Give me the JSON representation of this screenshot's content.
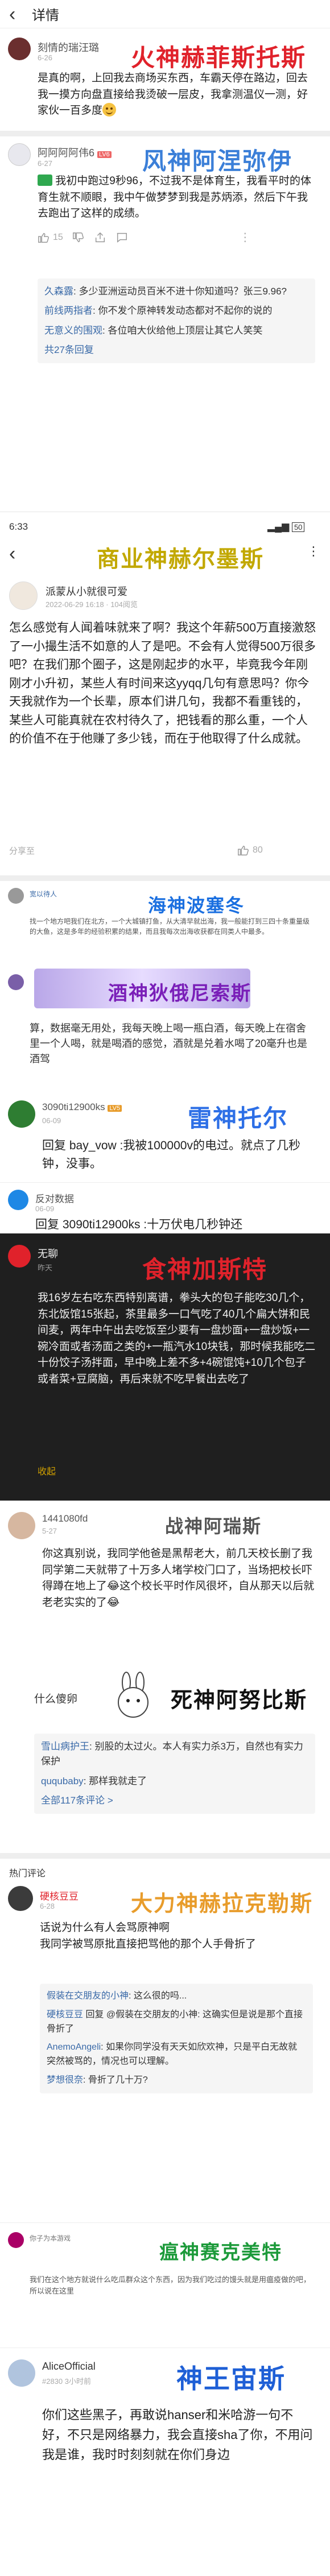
{
  "header": {
    "back_icon": "back-arrow-icon",
    "title": "详情"
  },
  "c1": {
    "user": "刻情的瑞汪璐",
    "date": "6-26",
    "banner": "火神赫菲斯托斯",
    "text": "是真的啊，上回我去商场买东西，车霸天停在路边，回去我一摸方向盘直接给我烫破一层皮，我拿测温仪一测，好家伙一百多度",
    "emoji": "smile-emoji"
  },
  "c2": {
    "user": "阿阿阿阿伟6",
    "level": "LV6",
    "date": "6-27",
    "banner": "风神阿涅弥伊",
    "text": "我初中跑过9秒96，不过我不是体育生，我看平时的体育生就不顺眼，我中午做梦梦到我是苏炳添，然后下午我去跑出了这样的成绩。",
    "likes": "15",
    "comments": "",
    "replies": [
      {
        "user": "久森露",
        "text": ": 多少亚洲运动员百米不进十你知道吗？张三9.96?"
      },
      {
        "user": "前线两指者",
        "text": ": 你不发个原神转发动态都对不起你的说的"
      },
      {
        "user": "无意义的围观",
        "text": ": 各位咱大伙给他上顶层让其它人笑笑"
      }
    ],
    "more": "共27条回复"
  },
  "status_bar": {
    "time": "6:33",
    "battery": "50"
  },
  "c3": {
    "banner": "商业神赫尔墨斯",
    "user": "派蒙从小就很可爱",
    "date": "2022-06-29 16:18 · 104阅览",
    "text": "怎么感觉有人闻着味就来了啊？我这个年薪500万直接激怒了一小撮生活不如意的人了是吧。不会有人觉得500万很多吧？在我们那个圈子，这是刚起步的水平，毕竟我今年刚刚才小升初，某些人有时间来这yyqq几句有意思吗？你今天我就作为一个长辈，原本们讲几句，我都不看重钱的，某些人可能真就在农村待久了，把钱看的那么重，一个人的价值不在于他赚了多少钱，而在于他取得了什么成就。",
    "share": "分享至",
    "likes": "80"
  },
  "c4": {
    "user": "宽以待人",
    "date": "",
    "banner": "海神波塞冬",
    "text": "找一个地方吧我们在北方，一个大城镇打鱼，从大清早就出海，我一般能打到三四十条重量级的大鱼，这是多年的经验积累的结果，而且我每次出海收获都在同类人中最多。"
  },
  "c5": {
    "user": "",
    "banner": "酒神狄俄尼索斯",
    "text": "算，数据毫无用处，我每天晚上喝一瓶白酒，每天晚上在宿舍里一个人喝，就是喝酒的感觉，酒就是兑着水喝了20毫升也是酒驾"
  },
  "c6": {
    "user": "3090ti12900ks",
    "level": "LV5",
    "date": "06-09",
    "banner": "雷神托尔",
    "text": "回复 bay_vow :我被100000v的电过。就点了几秒钟，没事。"
  },
  "c7": {
    "user": "反对数据",
    "date": "06-09",
    "reply_to": "3090ti12900ks",
    "text": "回复 3090ti12900ks :十万伏电几秒钟还"
  },
  "c8": {
    "user": "无聊",
    "sub": "",
    "date": "昨天",
    "banner": "食神加斯特",
    "text": "我16岁左右吃东西特别离谱，拳头大的包子能吃30几个，东北饭馆15张起，茶里最多一口气吃了40几个扁大饼和民间麦，两年中午出去吃饭至少要有一盘炒面+一盘炒饭+一碗冷面或者汤面之类的+一瓶汽水10块钱，那时候我能吃二十份饺子汤拌面，早中晚上差不多+4碗馄饨+10几个包子或者菜+豆腐脑，再后来就不吃早餐出去吃了",
    "expand": "收起",
    "likes": "",
    "comments": ""
  },
  "c9": {
    "user": "1441080fd",
    "date": "5-27",
    "banner": "战神阿瑞斯",
    "text": "你这真别说，我同学他爸是黑帮老大，前几天校长删了我同学第二天就带了十万多人堵学校门口了，当场把校长吓得蹲在地上了😂这个校长平时作风很坏，自从那天以后就老老实实的了😂",
    "likes": "",
    "comments": ""
  },
  "c10": {
    "user": "什么傻卵",
    "banner": "死神阿努比斯",
    "replies": [
      {
        "user": "雪山病护王",
        "text": ": 别股的太过火。本人有实力杀3万，自然也有实力保护"
      },
      {
        "user": "ququbaby",
        "text": ": 那样我就走了"
      },
      {
        "user": "",
        "text": ""
      }
    ],
    "more": "全部117条评论 >"
  },
  "hot_section": {
    "title": "热门评论"
  },
  "c11": {
    "user": "硬核豆豆",
    "date": "6-28",
    "banner": "大力神赫拉克勒斯",
    "text": "话说为什么有人会骂原神啊\n我同学被骂原批直接把骂他的那个人手骨折了",
    "likes": "",
    "comments": "",
    "replies": [
      {
        "user": "假装在交朋友的小神",
        "text": ": 这么很的吗..."
      },
      {
        "user": "硬核豆豆",
        "text": " 回复 @假装在交朋友的小神: 这确实但是说是那个直接骨折了"
      },
      {
        "user": "AnemoAngeli",
        "text": ": 如果你同学没有天天如欣欢神，只是平白无故就突然被骂的，情况也可以理解。"
      },
      {
        "user": "梦想很奈",
        "text": ": 骨折了几十万?"
      }
    ]
  },
  "c12": {
    "user": "你子为本游戏",
    "banner": "瘟神赛克美特",
    "text": "我们在这个地方就说什么吃瓜群众这个东西，因为我们吃过的馒头就是用瘟疫做的吧，所以说在这里"
  },
  "c13": {
    "user": "AliceOfficial",
    "sub": "#2830 3小时前",
    "banner": "神王宙斯",
    "text": "你们这些黑子，再敢说hanser和米哈游一句不好，不只是网络暴力，我会直接sha了你，不用问我是谁，我时时刻刻就在你们身边"
  },
  "colors": {
    "accent_red": "#e0222b",
    "accent_blue": "#3b7fd8",
    "link": "#3a6aa8",
    "dark_bg": "#1f1f1f"
  }
}
